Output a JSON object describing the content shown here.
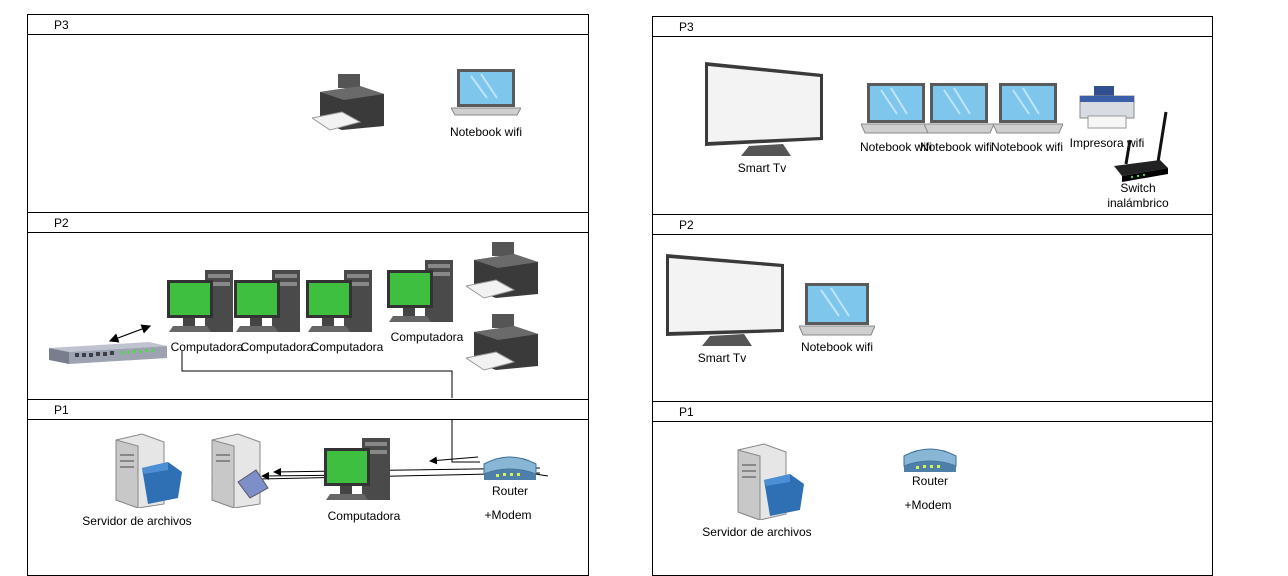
{
  "left": {
    "floors": {
      "p3": "P3",
      "p2": "P2",
      "p1": "P1"
    },
    "p3": {
      "notebook_label": "Notebook wifi"
    },
    "p2": {
      "pc1_label": "Computadora",
      "pc2_label": "Computadora",
      "pc3_label": "Computadora",
      "pc4_label": "Computadora"
    },
    "p1": {
      "file_server_label": "Servidor de archivos",
      "pc_label": "Computadora",
      "router_label": "Router",
      "modem_label": "+Modem"
    }
  },
  "right": {
    "floors": {
      "p3": "P3",
      "p2": "P2",
      "p1": "P1"
    },
    "p3": {
      "tv_label": "Smart Tv",
      "nb1_label": "Notebook wifi",
      "nb2_label": "Notebook wifi",
      "nb3_label": "Notebook wifi",
      "printer_label": "Impresora wifi",
      "switch_label_1": "Switch",
      "switch_label_2": "inalámbrico"
    },
    "p2": {
      "tv_label": "Smart Tv",
      "notebook_label": "Notebook wifi"
    },
    "p1": {
      "file_server_label": "Servidor de archivos",
      "router_label": "Router",
      "modem_label": "+Modem"
    }
  },
  "colors": {
    "screen_green": "#3fbf3f",
    "laptop_screen": "#7fc6ec",
    "device_gray": "#4a4a4a",
    "frame": "#000000"
  }
}
